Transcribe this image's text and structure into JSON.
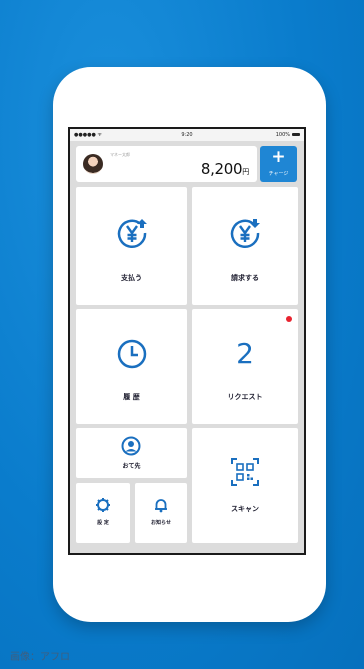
{
  "status_bar": {
    "carrier": "●●●●● ᯤ",
    "time": "9:20",
    "battery": "100%"
  },
  "balance_card": {
    "user_name": "マネー太郎",
    "amount": "8,200",
    "currency": "円"
  },
  "charge_button": {
    "plus": "+",
    "label": "チャージ"
  },
  "tiles": {
    "pay": {
      "label": "支払う",
      "icon": "yen-arrow-up-icon"
    },
    "request_money": {
      "label": "請求する",
      "icon": "yen-arrow-down-icon"
    },
    "history": {
      "label": "履 歴",
      "icon": "clock-icon"
    },
    "requests": {
      "count": "2",
      "label": "リクエスト"
    },
    "recipients": {
      "label": "おて先",
      "icon": "person-icon"
    },
    "settings": {
      "label": "設 定",
      "icon": "gear-icon"
    },
    "notifications": {
      "label": "お知らせ",
      "icon": "bell-icon"
    },
    "scan": {
      "label": "スキャン",
      "icon": "qr-code-icon"
    }
  },
  "colors": {
    "accent": "#1a6fbf",
    "badge": "#e8232f",
    "background": "#0a7ccc"
  },
  "caption": "画像：アフロ"
}
